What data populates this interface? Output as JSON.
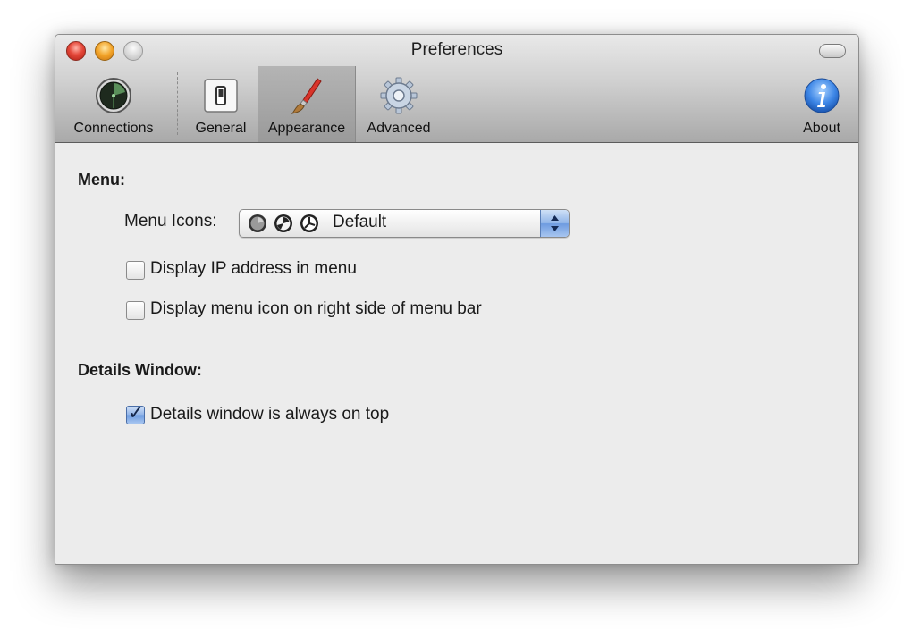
{
  "window": {
    "title": "Preferences"
  },
  "toolbar": {
    "items": [
      {
        "label": "Connections",
        "icon": "radar-icon"
      },
      {
        "label": "General",
        "icon": "switch-icon"
      },
      {
        "label": "Appearance",
        "icon": "paintbrush-icon",
        "selected": true
      },
      {
        "label": "Advanced",
        "icon": "gear-icon"
      },
      {
        "label": "About",
        "icon": "info-icon"
      }
    ]
  },
  "menu_section": {
    "heading": "Menu:",
    "menu_icons_label": "Menu Icons:",
    "menu_icons_value": "Default",
    "display_ip": {
      "label": "Display IP address in menu",
      "checked": false
    },
    "right_side": {
      "label": "Display menu icon on right side of menu bar",
      "checked": false
    }
  },
  "details_section": {
    "heading": "Details Window:",
    "always_on_top": {
      "label": "Details window is always on top",
      "checked": true
    }
  },
  "colors": {
    "accent": "#6d9be0",
    "window_bg": "#ececec"
  }
}
